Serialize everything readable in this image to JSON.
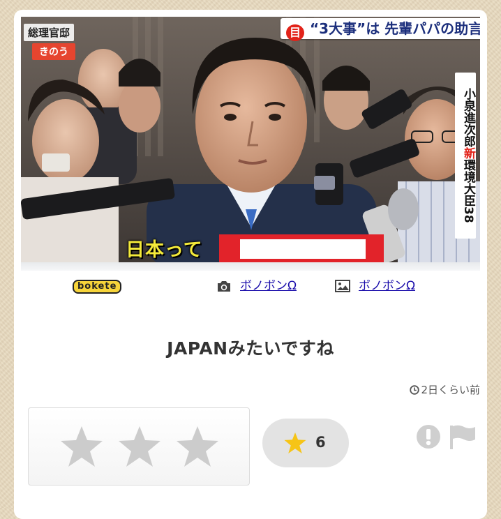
{
  "photo": {
    "top_caption_badge": "目",
    "top_caption": "“3大事”は 先輩パパの助言",
    "location_label": "総理官邸",
    "date_label": "きのう",
    "name_label": "小泉進次郎",
    "name_mark": "新",
    "title_label": "環境大臣",
    "age_label": "38",
    "subtitle_text": "日本って"
  },
  "meta": {
    "logo_text": "bokete",
    "photo_credit_icon": "camera-icon",
    "photo_credit": "ボノボンΩ",
    "image_credit_icon": "image-icon",
    "image_credit": "ボノボンΩ"
  },
  "post": {
    "caption": "JAPANみたいですね",
    "time_icon": "clock-icon",
    "time_ago": "2日くらい前"
  },
  "rating": {
    "star_count": 3,
    "score": "6",
    "star_color": "#f6c416",
    "empty_star_color": "#cccccc"
  },
  "actions": {
    "report_icon": "exclamation-circle-icon",
    "flag_icon": "flag-icon"
  }
}
